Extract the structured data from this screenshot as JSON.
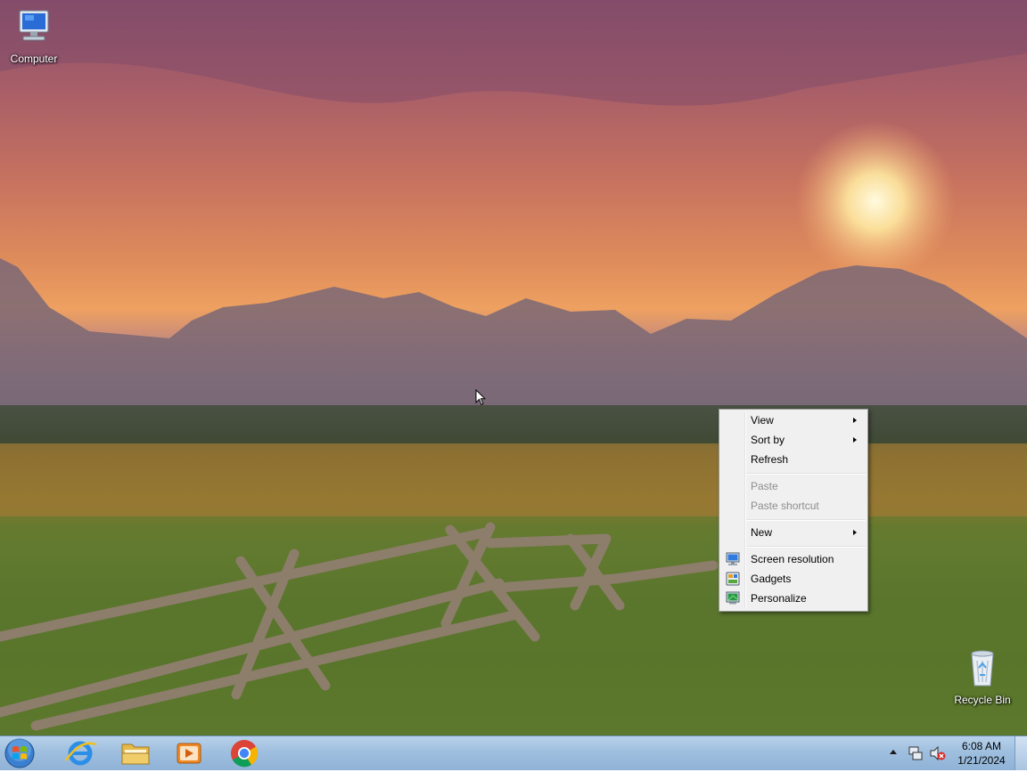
{
  "desktop": {
    "icons": [
      {
        "label": "Computer",
        "icon": "computer-icon"
      },
      {
        "label": "Recycle Bin",
        "icon": "recycle-bin-icon"
      }
    ]
  },
  "context_menu": {
    "items": [
      {
        "label": "View",
        "submenu": true,
        "enabled": true
      },
      {
        "label": "Sort by",
        "submenu": true,
        "enabled": true
      },
      {
        "label": "Refresh",
        "submenu": false,
        "enabled": true
      },
      {
        "label": "Paste",
        "submenu": false,
        "enabled": false
      },
      {
        "label": "Paste shortcut",
        "submenu": false,
        "enabled": false
      },
      {
        "label": "New",
        "submenu": true,
        "enabled": true
      },
      {
        "label": "Screen resolution",
        "icon": "monitor-icon",
        "enabled": true
      },
      {
        "label": "Gadgets",
        "icon": "gadgets-icon",
        "enabled": true
      },
      {
        "label": "Personalize",
        "icon": "personalize-icon",
        "enabled": true
      }
    ]
  },
  "taskbar": {
    "pinned": [
      {
        "name": "Internet Explorer",
        "icon": "internet-explorer-icon"
      },
      {
        "name": "Windows Explorer",
        "icon": "folder-icon"
      },
      {
        "name": "Windows Media Player",
        "icon": "media-player-icon"
      },
      {
        "name": "Google Chrome",
        "icon": "chrome-icon"
      }
    ],
    "tray_icons": [
      "show-hidden-icons-arrow",
      "network-icon",
      "volume-muted-icon"
    ],
    "clock": {
      "time": "6:08 AM",
      "date": "1/21/2024"
    }
  },
  "colors": {
    "taskbar": "#9fbfdf",
    "menu_bg": "#f0f0f0",
    "menu_disabled_text": "#8d8d8d"
  }
}
